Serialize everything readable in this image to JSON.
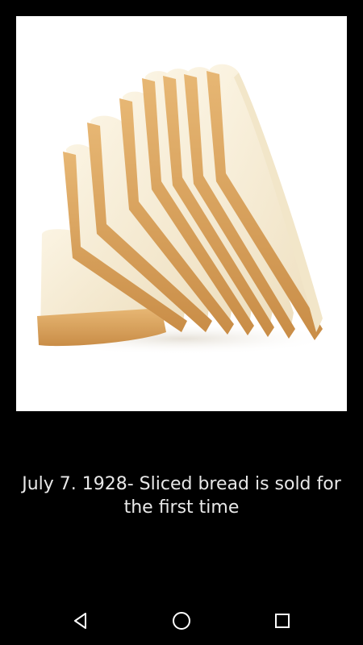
{
  "image": {
    "subject": "bread-slices"
  },
  "caption": {
    "text": "July 7. 1928- Sliced bread is sold for the first time"
  },
  "navigation": {
    "back_icon": "back-triangle-icon",
    "home_icon": "home-circle-icon",
    "recents_icon": "recents-square-icon",
    "icon_color": "#ffffff"
  },
  "colors": {
    "background": "#000000",
    "caption_text": "#e8e8e8",
    "crust": "#d9a45e",
    "crumb": "#f6ecd6"
  }
}
